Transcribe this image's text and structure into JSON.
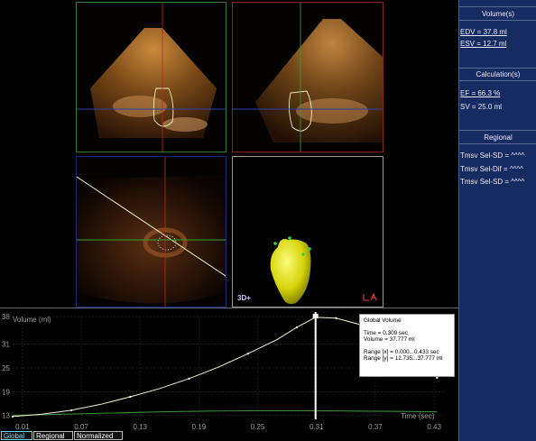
{
  "side_panel": {
    "volumes_title": "Volume(s)",
    "edv": "EDV = 37.8 ml",
    "esv": "ESV = 12.7 ml",
    "calc_title": "Calculation(s)",
    "ef": "EF = 66.3 %",
    "sv": "SV = 25.0 ml",
    "regional_title": "Regional",
    "tmsv_sd": "Tmsv Sel-SD = ^^^^",
    "tmsv_dif": "Tmsv Sel-Dif = ^^^^",
    "tmsv_sd2": "Tmsv Sel-SD = ^^^^"
  },
  "views": {
    "render_label": "3D+",
    "la_icon": "left-atrium-icon"
  },
  "graph": {
    "ylabel": "Volume (ml)",
    "xlabel": "Time (sec)",
    "y_ticks": [
      "38",
      "31",
      "25",
      "19",
      "13"
    ],
    "x_ticks": [
      "0.01",
      "0.07",
      "0.13",
      "0.19",
      "0.25",
      "0.31",
      "0.37",
      "0.43"
    ]
  },
  "tooltip": {
    "title": "Global Volume",
    "time": "Time = 0.309 sec",
    "volume": "Volume = 37.777 ml",
    "range_x": "Range [x] = 0.000...0.433 sec",
    "range_y": "Range [y] = 12.735...37.777 ml"
  },
  "tabs": {
    "global": "Global",
    "regional": "Regional",
    "normalized": "Normalized"
  },
  "colors": {
    "panel_bg": "#172b63",
    "curve": "#f2f2d0",
    "flat_curve": "#3d8a3d",
    "active_tab": "#6fd7f2"
  },
  "chart_data": {
    "type": "line",
    "xlabel": "Time (sec)",
    "ylabel": "Volume (ml)",
    "xlim": [
      0.0,
      0.44
    ],
    "ylim": [
      12.0,
      38.0
    ],
    "series": [
      {
        "x": [
          0.0,
          0.03,
          0.06,
          0.09,
          0.12,
          0.15,
          0.18,
          0.21,
          0.24,
          0.27,
          0.29,
          0.309,
          0.33,
          0.36,
          0.39,
          0.42,
          0.433
        ],
        "values": [
          12.7,
          13.3,
          14.3,
          15.8,
          17.7,
          19.8,
          22.3,
          25.2,
          28.6,
          32.2,
          35.3,
          37.8,
          37.6,
          35.6,
          31.0,
          26.0,
          22.5
        ]
      },
      {
        "x": [
          0.0,
          0.05,
          0.1,
          0.15,
          0.2,
          0.25,
          0.3,
          0.35,
          0.4,
          0.433
        ],
        "values": [
          13.0,
          13.3,
          13.6,
          13.9,
          14.1,
          14.2,
          14.2,
          14.1,
          14.0,
          13.9
        ]
      }
    ],
    "cursor_x": 0.309
  }
}
